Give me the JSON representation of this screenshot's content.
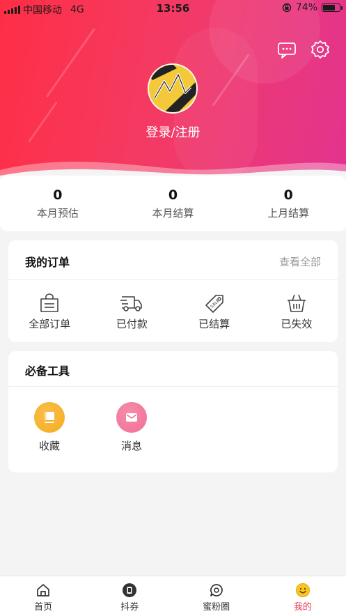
{
  "status_bar": {
    "carrier": "中国移动",
    "network": "4G",
    "time": "13:56",
    "battery": "74%",
    "battery_level": 0.74
  },
  "header": {
    "message_icon": "message-icon",
    "settings_icon": "gear-icon",
    "login_label": "登录/注册"
  },
  "stats": [
    {
      "value": "0",
      "label": "本月预估"
    },
    {
      "value": "0",
      "label": "本月结算"
    },
    {
      "value": "0",
      "label": "上月结算"
    }
  ],
  "orders": {
    "title": "我的订单",
    "view_all": "查看全部",
    "items": [
      {
        "label": "全部订单",
        "icon": "bag-icon"
      },
      {
        "label": "已付款",
        "icon": "truck-icon"
      },
      {
        "label": "已结算",
        "icon": "tag-icon"
      },
      {
        "label": "已失效",
        "icon": "basket-icon"
      }
    ]
  },
  "tools": {
    "title": "必备工具",
    "items": [
      {
        "label": "收藏",
        "icon": "book-icon",
        "color": "#f6ad1c"
      },
      {
        "label": "消息",
        "icon": "mail-icon",
        "color": "#f26f95"
      }
    ]
  },
  "tabbar": {
    "items": [
      {
        "label": "首页",
        "icon": "home-icon"
      },
      {
        "label": "抖券",
        "icon": "coupon-icon"
      },
      {
        "label": "蜜粉圈",
        "icon": "chat-circle-icon"
      },
      {
        "label": "我的",
        "icon": "smile-icon"
      }
    ],
    "active_color": "#e8374e"
  },
  "colors": {
    "hero_start": "#ff2e45",
    "hero_end": "#e2348f",
    "accent": "#e8374e"
  }
}
